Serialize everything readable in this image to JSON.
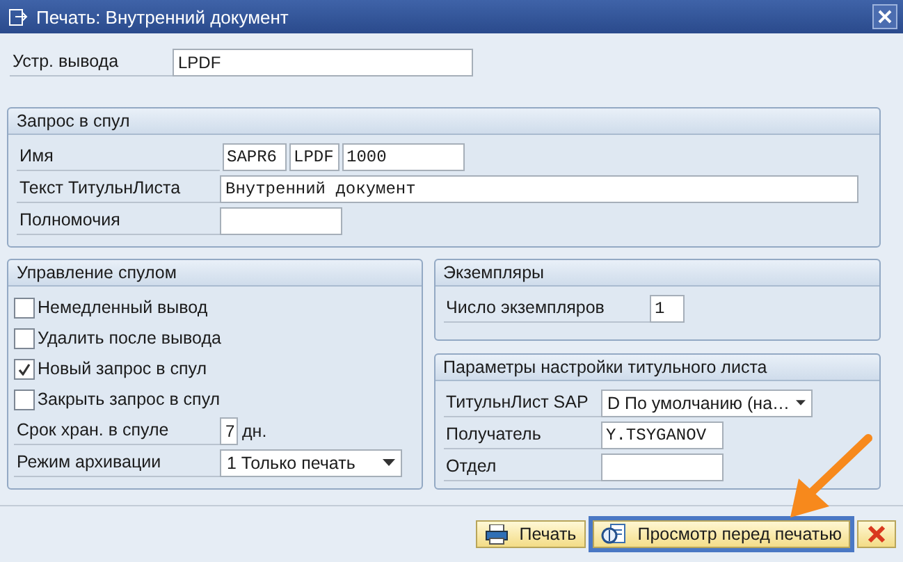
{
  "window": {
    "title": "Печать: Внутренний документ"
  },
  "output_device": {
    "label": "Устр. вывода",
    "value": "LPDF"
  },
  "spool_request": {
    "title": "Запрос в спул",
    "name": {
      "label": "Имя",
      "values": [
        "SAPR6",
        "LPDF",
        "1000"
      ]
    },
    "cover_text": {
      "label": "Текст ТитульнЛиста",
      "value": "Внутренний документ"
    },
    "authorization": {
      "label": "Полномочия"
    }
  },
  "spool_control": {
    "title": "Управление спулом",
    "options": [
      {
        "label": "Немедленный вывод",
        "checked": false
      },
      {
        "label": "Удалить после вывода",
        "checked": false
      },
      {
        "label": "Новый запрос в спул",
        "checked": true
      },
      {
        "label": "Закрыть запрос в спул",
        "checked": false
      }
    ],
    "retention": {
      "label": "Срок хран. в спуле",
      "value": "7",
      "unit": "дн."
    },
    "archiving": {
      "label": "Режим архивации",
      "value": "1 Только печать"
    }
  },
  "copies": {
    "title": "Экземпляры",
    "label": "Число экземпляров",
    "value": "1"
  },
  "cover_sheet": {
    "title": "Параметры настройки титульного листа",
    "sap_cover": {
      "label": "ТитульнЛист SAP",
      "value": "D По умолчанию (на…"
    },
    "recipient": {
      "label": "Получатель",
      "value": "Y.TSYGANOV"
    },
    "department": {
      "label": "Отдел"
    }
  },
  "buttons": [
    {
      "kind": "print",
      "label": "Печать",
      "selected": false
    },
    {
      "kind": "preview",
      "label": "Просмотр перед печатью",
      "selected": true
    },
    {
      "kind": "cancel",
      "selected": false
    }
  ]
}
